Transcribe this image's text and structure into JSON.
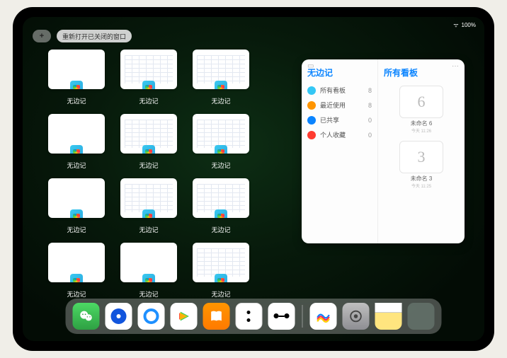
{
  "statusbar": {
    "time": "",
    "battery": "100%",
    "signal": "•••"
  },
  "toolbar": {
    "plus_label": "+",
    "reopen_label": "重新打开已关闭的窗口"
  },
  "app_name": "无边记",
  "thumbs": [
    {
      "label": "无边记",
      "variant": "blank"
    },
    {
      "label": "无边记",
      "variant": "content"
    },
    {
      "label": "无边记",
      "variant": "content"
    },
    null,
    {
      "label": "无边记",
      "variant": "blank"
    },
    {
      "label": "无边记",
      "variant": "content"
    },
    {
      "label": "无边记",
      "variant": "content"
    },
    null,
    {
      "label": "无边记",
      "variant": "blank"
    },
    {
      "label": "无边记",
      "variant": "content"
    },
    {
      "label": "无边记",
      "variant": "content"
    },
    null,
    {
      "label": "无边记",
      "variant": "blank"
    },
    {
      "label": "无边记",
      "variant": "blank"
    },
    {
      "label": "无边记",
      "variant": "content"
    },
    null
  ],
  "panel": {
    "ellipsis": "···",
    "left_title": "无边记",
    "right_title": "所有看板",
    "categories": [
      {
        "label": "所有看板",
        "count": "8",
        "color": "#34c7f5"
      },
      {
        "label": "最近使用",
        "count": "8",
        "color": "#ff9500"
      },
      {
        "label": "已共享",
        "count": "0",
        "color": "#0a84ff"
      },
      {
        "label": "个人收藏",
        "count": "0",
        "color": "#ff3b30"
      }
    ],
    "boards": [
      {
        "glyph": "6",
        "label": "未命名 6",
        "sub": "今天 11:26"
      },
      {
        "glyph": "3",
        "label": "未命名 3",
        "sub": "今天 11:25"
      }
    ]
  },
  "dock": {
    "apps": [
      {
        "name": "wechat-icon"
      },
      {
        "name": "quark-icon"
      },
      {
        "name": "browser-icon"
      },
      {
        "name": "video-icon"
      },
      {
        "name": "books-icon"
      },
      {
        "name": "dice-icon"
      },
      {
        "name": "graph-icon"
      }
    ],
    "apps_right": [
      {
        "name": "freeform-icon"
      },
      {
        "name": "settings-icon"
      },
      {
        "name": "notes-icon"
      },
      {
        "name": "recent-apps-icon"
      }
    ]
  }
}
